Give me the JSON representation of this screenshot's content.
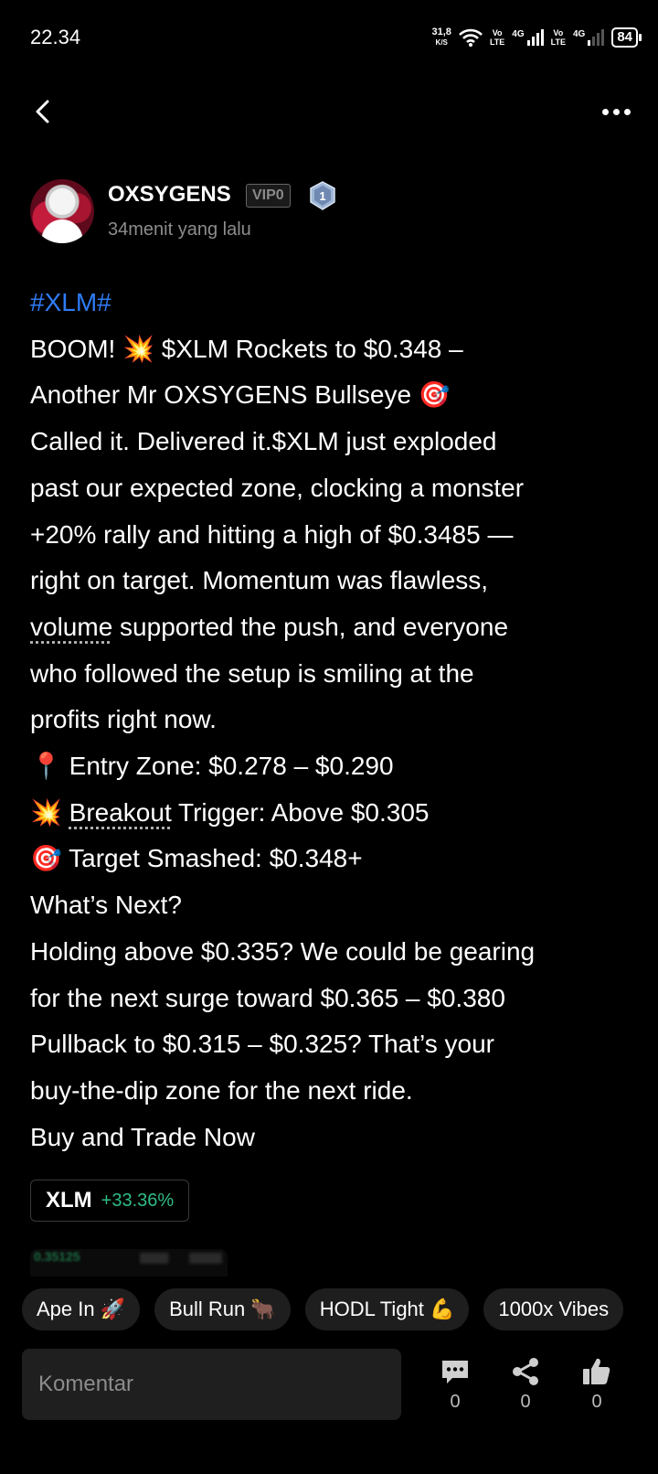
{
  "status_bar": {
    "time": "22.34",
    "net_speed": "31,8",
    "net_speed_unit": "K/S",
    "volte1": [
      "Vo",
      "LTE"
    ],
    "volte2": [
      "Vo",
      "LTE"
    ],
    "network1": "4G",
    "network2": "4G",
    "battery": "84"
  },
  "author": {
    "name": "OXSYGENS",
    "vip": "VIP0",
    "level": "1",
    "time_ago": "34menit yang lalu"
  },
  "post": {
    "hashtag": "#XLM#",
    "lines": {
      "l1": "BOOM! 💥 $XLM Rockets to $0.348 –",
      "l2": "Another Mr OXSYGENS Bullseye 🎯",
      "l3": "Called it. Delivered it.$XLM  just exploded",
      "l4": "past our expected zone, clocking a monster",
      "l5": "+20% rally and hitting a high of $0.3485 —",
      "l6": "right on target. Momentum was flawless,",
      "l7_link": "volume",
      "l7_rest": " supported the push, and everyone",
      "l8": "who followed the setup is smiling at the",
      "l9": "profits right now.",
      "l10": "📍 Entry Zone: $0.278 – $0.290",
      "l11_pre": "💥 ",
      "l11_link": "Breakout",
      "l11_rest": " Trigger: Above $0.305",
      "l12": "🎯 Target Smashed: $0.348+",
      "l13": "What’s Next?",
      "l14": "Holding above $0.335? We could be gearing",
      "l15": "for the next surge toward $0.365 – $0.380",
      "l16": "Pullback to $0.315 – $0.325? That’s your",
      "l17": "buy-the-dip zone for the next ride.",
      "l18": "Buy and Trade Now"
    }
  },
  "coin": {
    "symbol": "XLM",
    "change": "+33.36%",
    "change_color": "#2ebd85"
  },
  "image_preview": {
    "price": "0.35125"
  },
  "reactions": [
    {
      "label": "Ape In 🚀"
    },
    {
      "label": "Bull Run 🐂"
    },
    {
      "label": "HODL Tight 💪"
    },
    {
      "label": "1000x Vibes"
    }
  ],
  "bottom_bar": {
    "comment_placeholder": "Komentar",
    "comments_count": "0",
    "shares_count": "0",
    "likes_count": "0"
  },
  "colors": {
    "background": "#000000",
    "hashtag": "#2f7cf6",
    "muted_text": "#8c8c8c",
    "chip_bg": "#1e1e1e"
  },
  "icons": [
    "back-chevron-icon",
    "more-dots-icon",
    "wifi-icon",
    "signal-icon",
    "battery-icon",
    "level-shield-icon",
    "comment-icon",
    "share-icon",
    "thumbs-up-icon"
  ]
}
